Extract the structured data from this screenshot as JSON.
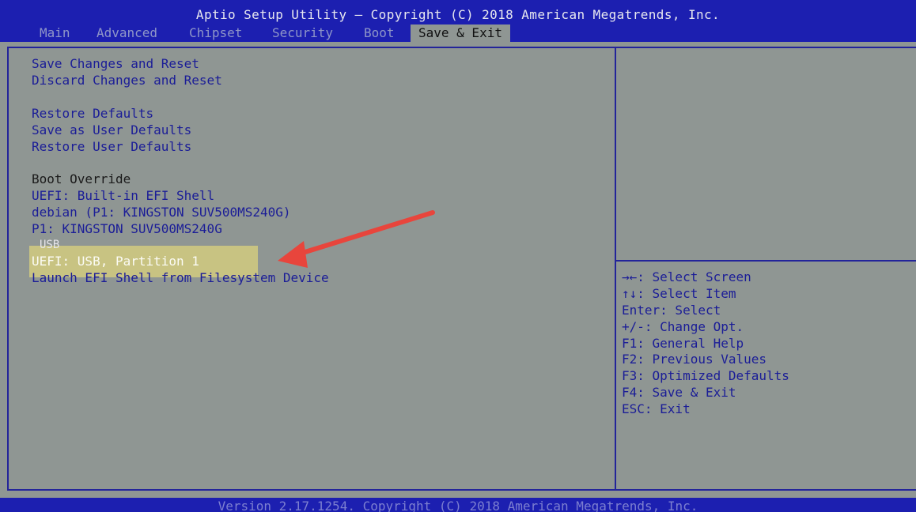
{
  "header": {
    "title": "Aptio Setup Utility – Copyright (C) 2018 American Megatrends, Inc.",
    "tabs": [
      {
        "label": "Main"
      },
      {
        "label": "Advanced"
      },
      {
        "label": "Chipset"
      },
      {
        "label": "Security"
      },
      {
        "label": "Boot"
      },
      {
        "label": "Save & Exit",
        "active": true
      }
    ]
  },
  "menu": {
    "save_changes_reset": "Save Changes and Reset",
    "discard_changes_reset": "Discard Changes and Reset",
    "restore_defaults": "Restore Defaults",
    "save_user_defaults": "Save as User Defaults",
    "restore_user_defaults": "Restore User Defaults",
    "boot_override_header": "Boot Override",
    "uefi_efi_shell": "UEFI: Built-in EFI Shell",
    "debian": "debian (P1: KINGSTON SUV500MS240G)",
    "p1_kingston": "P1: KINGSTON SUV500MS240G",
    "usb": "USB",
    "uefi_usb_partition": "UEFI:  USB, Partition 1",
    "launch_efi_shell": "Launch EFI Shell from Filesystem Device"
  },
  "help": {
    "select_screen_key": "→←",
    "select_screen": ": Select Screen",
    "select_item_key": "↑↓",
    "select_item": ": Select Item",
    "enter_select": "Enter: Select",
    "change_opt": "+/-: Change Opt.",
    "f1": "F1: General Help",
    "f2": "F2: Previous Values",
    "f3": "F3: Optimized Defaults",
    "f4": "F4: Save & Exit",
    "esc": "ESC: Exit"
  },
  "footer": {
    "version": "Version 2.17.1254. Copyright (C) 2018 American Megatrends, Inc."
  },
  "colors": {
    "header_blue": "#1c1fb0",
    "panel_gray": "#8f9693",
    "item_blue": "#1b1d97",
    "highlight_yellow": "#ecdf78",
    "annotation_arrow": "#e8453c"
  },
  "icons": {
    "annotation": "red-arrow-icon"
  }
}
